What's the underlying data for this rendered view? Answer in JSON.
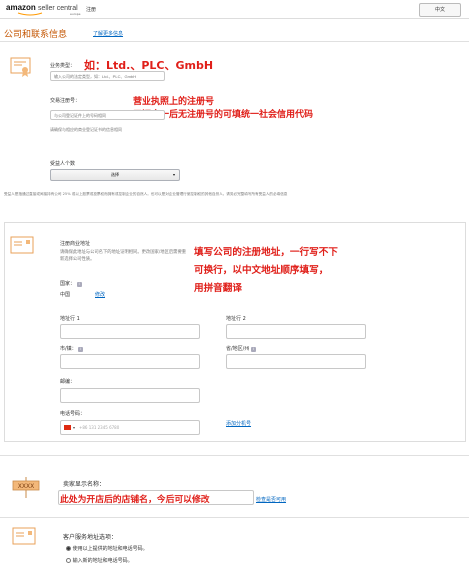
{
  "header": {
    "logo_brand": "amazon",
    "logo_product": "seller central",
    "logo_region": "europe",
    "page_label": "注册",
    "language_button": "中文"
  },
  "section": {
    "title": "公司和联系信息",
    "learn_more": "了解更多信息"
  },
  "business": {
    "type_label": "业务类型：",
    "type_placeholder": "输入公司的法定类型，如：Ltd.、PLC、GmbH",
    "type_annotation": "如：Ltd.、PLC、GmbH",
    "reg_label": "交易注册号：",
    "reg_placeholder": "与公司登记证件上的号码相同",
    "reg_annotation_1": "营业执照上的注册号",
    "reg_annotation_2": "三证合一后无注册号的可填统一社会信用代码",
    "reg_hint": "请确保与相应的商业登记证书的信息相同",
    "beneficiary_label": "受益人个数",
    "beneficiary_select": "选择",
    "beneficiary_note": "受益人是指通过直接或间接持有公司 25% 或以上股票或投票权而拥有或控制企业的自然人。也可以是对企业管理行使控制权的其他自然人。请务必完整填写所有受益人的必填信息"
  },
  "address": {
    "label": "注册商业地址",
    "desc": "请确保此地址与公司名下的地址证明相同。更改国家/地区后需要重新选择公司性质。",
    "annotation_1": "填写公司的注册地址，一行写不下",
    "annotation_2": "可换行，以中文地址顺序填写，",
    "annotation_3": "用拼音翻译",
    "country_label": "国家：",
    "country_value": "中国",
    "country_change": "修改",
    "line1_label": "地址行 1",
    "line2_label": "地址行 2",
    "city_label": "市/镇：",
    "state_label": "省/地区/州",
    "zip_label": "邮编：",
    "phone_label": "电话号码：",
    "phone_placeholder": "+86 131 2345 6780",
    "add_phone": "添加分机号"
  },
  "seller": {
    "label": "卖家显示名称：",
    "annotation": "此处为开店后的店铺名，今后可以修改",
    "check_link": "检查是否可用",
    "badge_text": "XXXX"
  },
  "service": {
    "label": "客户服务地址选项：",
    "option_1": "使用以上提供的地址和电话号码。",
    "option_2": "输入新的地址和电话号码。"
  }
}
